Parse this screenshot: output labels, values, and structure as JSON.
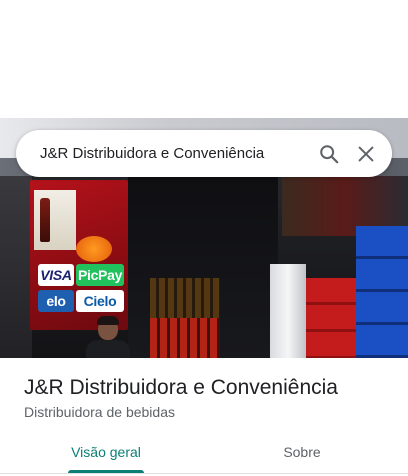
{
  "search": {
    "query": "J&R Distribuidora e Conveniência",
    "search_icon": "search-icon",
    "close_icon": "close-icon"
  },
  "photo": {
    "payment_logos": [
      "VISA",
      "PicPay",
      "elo",
      "Cielo"
    ]
  },
  "place": {
    "title": "J&R Distribuidora e Conveniência",
    "category": "Distribuidora de bebidas"
  },
  "tabs": [
    {
      "label": "Visão geral",
      "active": true
    },
    {
      "label": "Sobre",
      "active": false
    }
  ],
  "colors": {
    "accent": "#0b7f74",
    "text_primary": "#202124",
    "text_secondary": "#5f6368"
  }
}
